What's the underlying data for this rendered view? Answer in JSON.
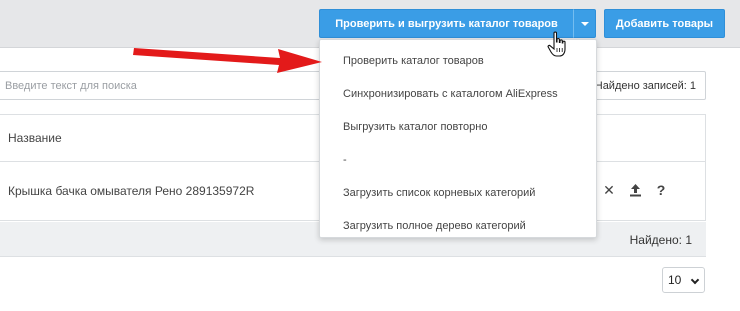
{
  "toolbar": {
    "verify_export_label": "Проверить и выгрузить каталог товаров",
    "add_products_label": "Добавить товары"
  },
  "search": {
    "placeholder": "Введите текст для поиска",
    "found_label": "Найдено записей: 1"
  },
  "table": {
    "header_name": "Название",
    "rows": [
      {
        "name": "Крышка бачка омывателя Рено 289135972R"
      }
    ],
    "found_footer": "Найдено: 1"
  },
  "pagination": {
    "page_size": "10"
  },
  "dropdown": {
    "items": [
      "Проверить каталог товаров",
      "Синхронизировать с каталогом AliExpress",
      "Выгрузить каталог повторно",
      "-",
      "Загрузить список корневых категорий",
      "Загрузить полное дерево категорий"
    ]
  },
  "colors": {
    "primary": "#3a9de6",
    "annotation_arrow": "#e31a1a",
    "toolbar_bg": "#e6e7e9"
  }
}
